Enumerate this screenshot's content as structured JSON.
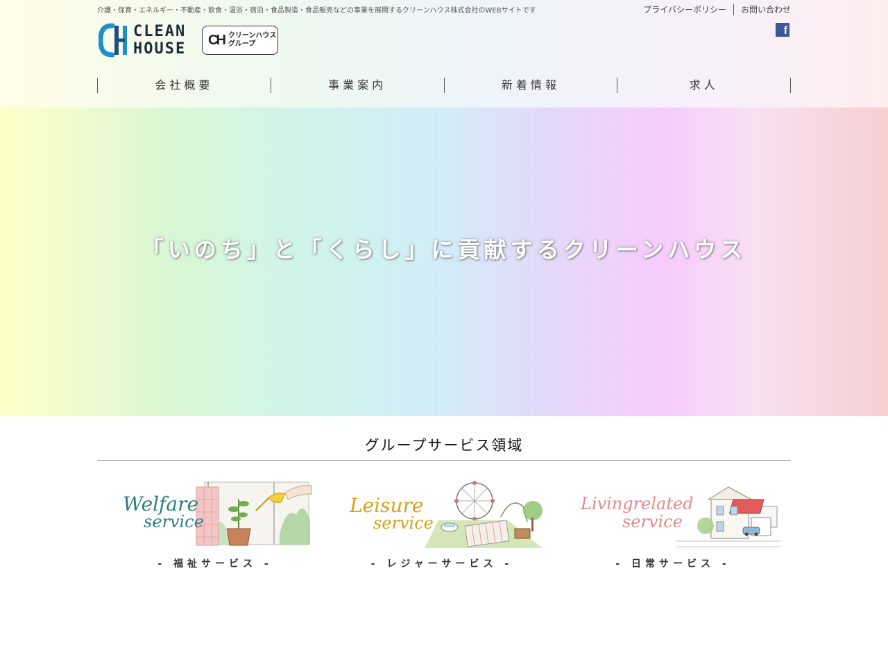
{
  "header": {
    "tagline": "介護・保育・エネルギー・不動産・飲食・温浴・宿泊・食品製造・食品販売などの事業を展開するクリーンハウス株式会社のWEBサイトです",
    "util_links": [
      {
        "label": "プライバシーポリシー"
      },
      {
        "label": "お問い合わせ"
      }
    ],
    "facebook_icon": "facebook-icon",
    "logo": {
      "line1": "CLEAN",
      "line2": "HOUSE",
      "mark": "CH"
    },
    "group_badge": {
      "mark": "CH",
      "line1": "クリーンハウス",
      "line2": "グループ"
    }
  },
  "nav": {
    "items": [
      {
        "label": "会社概要"
      },
      {
        "label": "事業案内"
      },
      {
        "label": "新着情報"
      },
      {
        "label": "求人"
      }
    ]
  },
  "hero": {
    "title": "「いのち」と「くらし」に貢献するクリーンハウス"
  },
  "services": {
    "title": "グループサービス領域",
    "items": [
      {
        "caption": "- 福祉サービス -",
        "script_line1": "Welfare",
        "script_line2": "service",
        "accent": "#2f7d80"
      },
      {
        "caption": "- レジャーサービス -",
        "script_line1": "Leisure",
        "script_line2": "service",
        "accent": "#d4a21c"
      },
      {
        "caption": "- 日常サービス -",
        "script_line1": "Livingrelated",
        "script_line2": "service",
        "accent": "#e08a8a"
      }
    ]
  },
  "colors": {
    "logo_blue": "#1f8fc9",
    "logo_teal": "#1b4f7a",
    "facebook": "#3b5998"
  }
}
